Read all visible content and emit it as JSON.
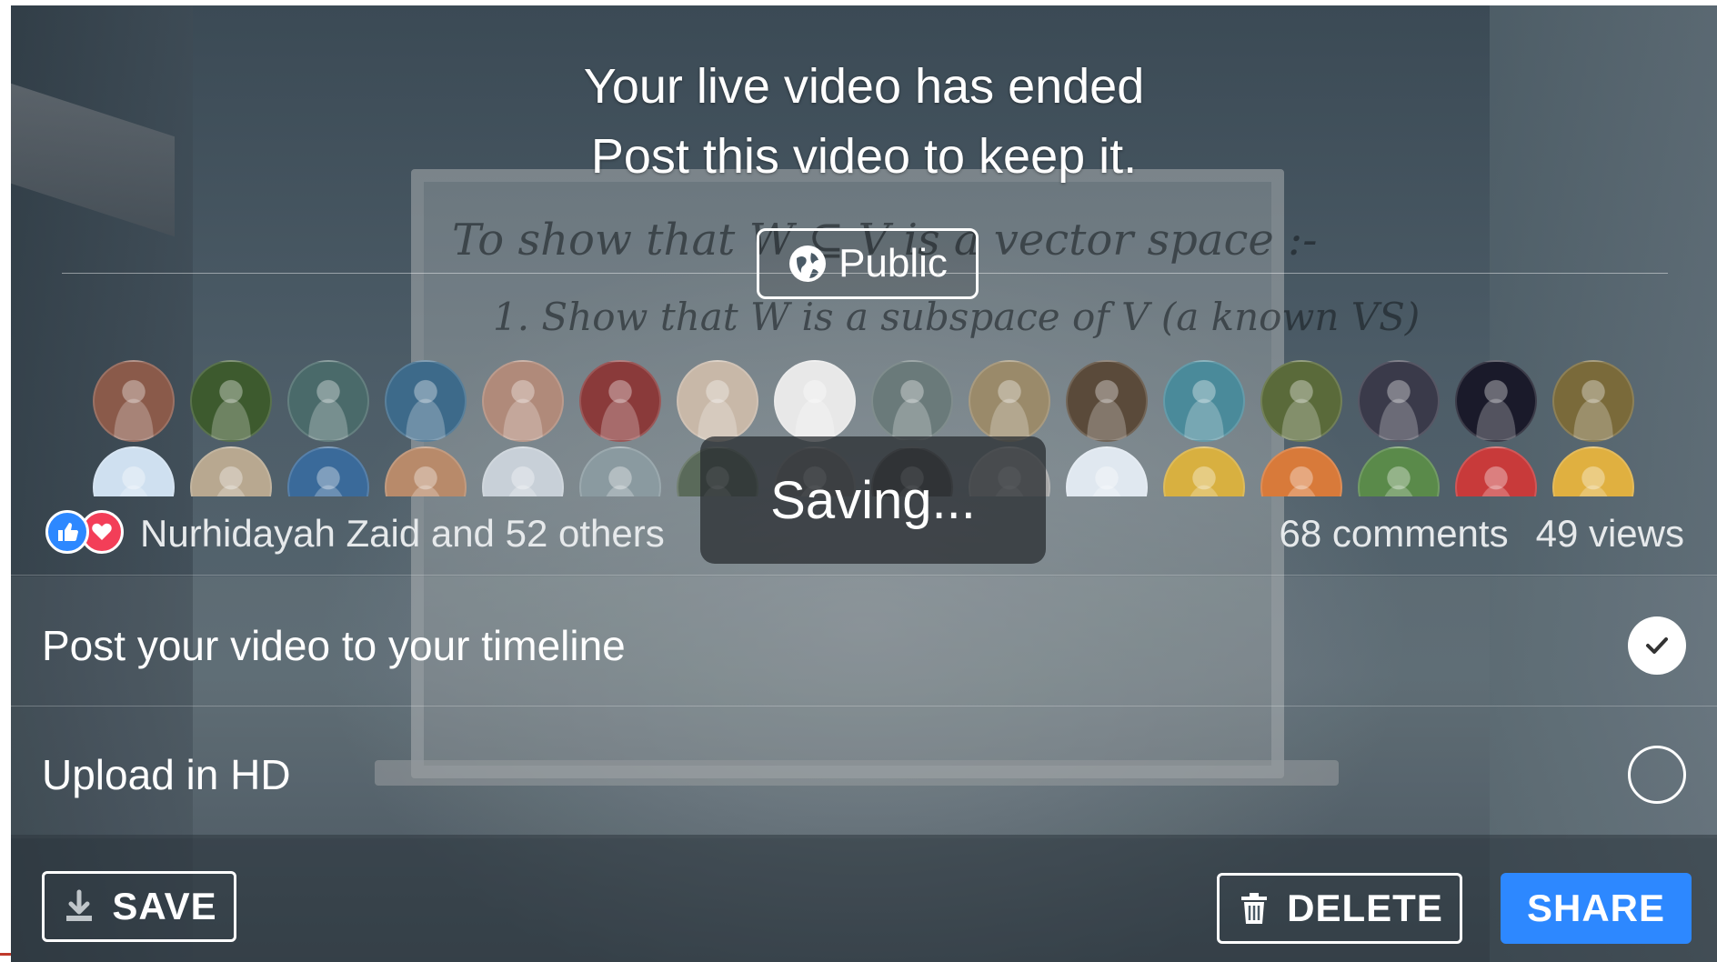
{
  "header": {
    "title": "Your live video has ended",
    "subtitle": "Post this video to keep it."
  },
  "privacy": {
    "label": "Public",
    "icon": "globe-icon"
  },
  "viewers": {
    "row1_colors": [
      "#8a5a4a",
      "#3d5a2e",
      "#4a6a6a",
      "#3d6a8a",
      "#b08a7a",
      "#8a3a3a",
      "#c8b8a8",
      "#e8e8e8",
      "#6a7a7a",
      "#9a8a6a",
      "#5a4a3a",
      "#4a8a9a",
      "#5a6a3a",
      "#3a3a4a",
      "#1a1a2a",
      "#7a6a3a"
    ],
    "row2_colors": [
      "#cfe0f0",
      "#b8a890",
      "#3a6a9a",
      "#b88a6a",
      "#c8d0d8",
      "#8a9aa0",
      "#5a6a5a",
      "#7a7a7a",
      "#4a4a4a",
      "#a8a8a8",
      "#e0e8f0",
      "#d8b040",
      "#d87a3a",
      "#5a8a4a",
      "#c83a3a",
      "#e0b040"
    ]
  },
  "reactions": {
    "icons": [
      "like-icon",
      "love-icon"
    ],
    "colors": {
      "like": "#2d88ff",
      "love": "#f33e58"
    },
    "summary": "Nurhidayah Zaid and 52 others"
  },
  "stats": {
    "comments": "68 comments",
    "views": "49 views"
  },
  "options": [
    {
      "label": "Post your video to your timeline",
      "checked": true
    },
    {
      "label": "Upload in HD",
      "checked": false
    }
  ],
  "status": {
    "saving": "Saving..."
  },
  "actions": {
    "save": "SAVE",
    "delete": "DELETE",
    "share": "SHARE",
    "accent": "#2d88ff"
  },
  "background": {
    "board_line1": "To show that W ⊆ V is a vector space :-",
    "board_line2": "1. Show that W is a subspace of V (a known VS)"
  }
}
